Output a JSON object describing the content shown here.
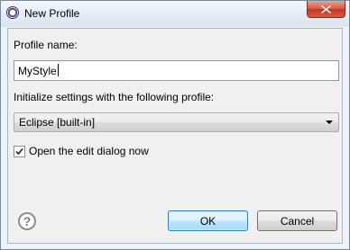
{
  "window": {
    "title": "New Profile"
  },
  "form": {
    "profile_name_label": "Profile name:",
    "profile_name_value": "MyStyle",
    "init_label": "Initialize settings with the following profile:",
    "init_profile_selected": "Eclipse [built-in]",
    "open_edit_label": "Open the edit dialog now",
    "open_edit_checked": true
  },
  "buttons": {
    "ok": "OK",
    "cancel": "Cancel",
    "help_glyph": "?"
  },
  "icons": {
    "app": "eclipse-icon",
    "close": "close-icon",
    "help": "help-icon",
    "dropdown": "chevron-down-icon"
  }
}
